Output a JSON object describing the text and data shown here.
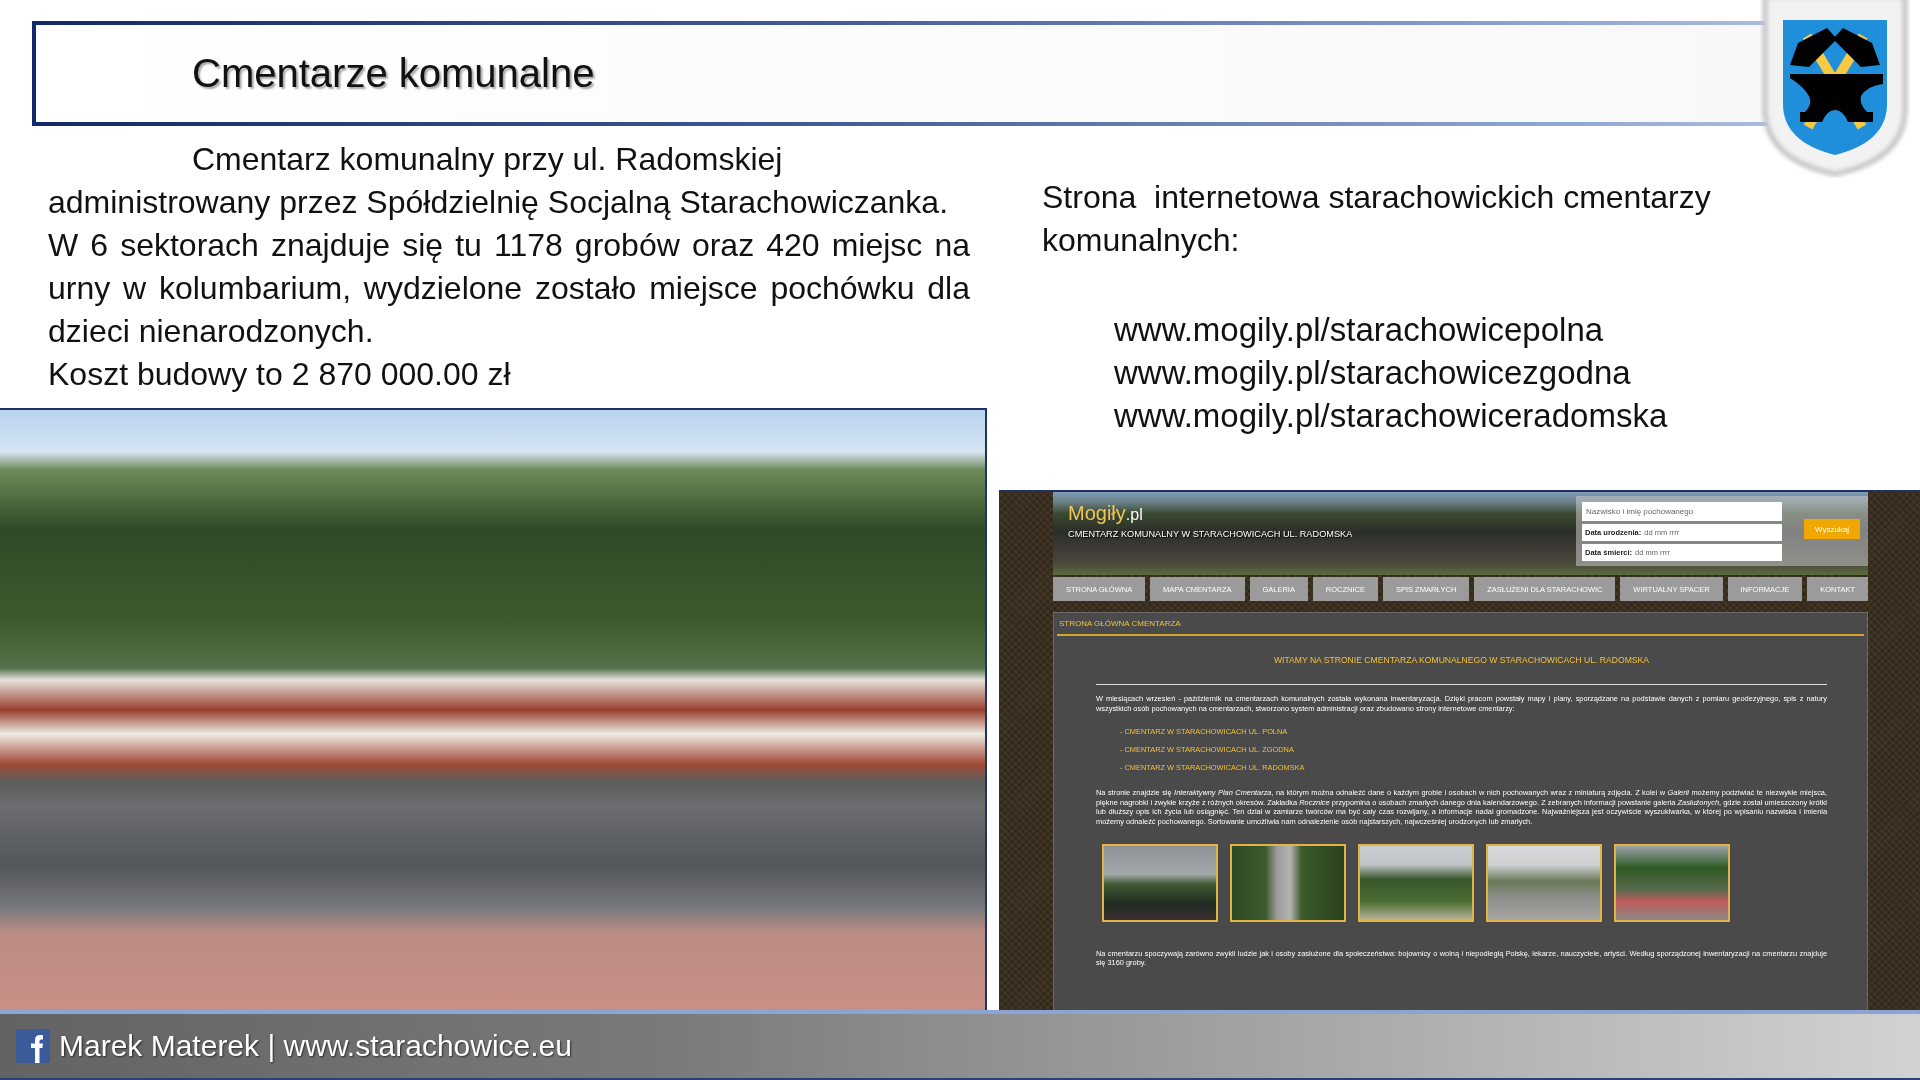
{
  "title": "Cmentarze komunalne",
  "intro": {
    "paragraphs": [
      "Cmentarz komunalny przy ul. Radomskiej\nadministrowany przez Spółdzielnię Socjalną Starachowiczanka.",
      "W 6 sektorach znajduje się tu 1178 grobów oraz 420 miejsc na urny w kolumbarium, wydzielone zostało miejsce pochówku dla dzieci nienarodzonych.",
      "Koszt budowy to 2 870 000.00 zł"
    ]
  },
  "links_intro": "Strona  internetowa starachowickich cmentarzy komunalnych:",
  "links": [
    "www.mogily.pl/starachowicepolna",
    "www.mogily.pl/starachowicezgodna",
    "www.mogily.pl/starachowiceradomska"
  ],
  "website": {
    "logo": {
      "name": "Mogiły",
      "suffix": ".pl"
    },
    "subtitle": "CMENTARZ KOMUNALNY W STARACHOWICACH UL. RADOMSKA",
    "search": {
      "name_placeholder": "Nazwisko i imię pochowanego",
      "date_fields": [
        {
          "label": "Data urodzenia:",
          "placeholder": "dd mm rrrr"
        },
        {
          "label": "Data śmierci:",
          "placeholder": "dd mm rrrr"
        }
      ],
      "button": "Wyszukaj"
    },
    "nav": [
      "STRONA GŁÓWNA",
      "MAPA CMENTARZA",
      "GALERIA",
      "ROCZNICE",
      "SPIS ZMARŁYCH",
      "ZASŁUŻENI DLA STARACHOWIC",
      "WIRTUALNY SPACER",
      "INFORMACJE",
      "KONTAKT"
    ],
    "section_title": "STRONA GŁÓWNA CMENTARZA",
    "heading": "WITAMY NA STRONIE CMENTARZA KOMUNALNEGO W STARACHOWICACH UL. RADOMSKA",
    "intro": "W miesiącach wrzesień - październik na cmentarzach komunalnych została wykonana inwentaryzacja. Dzięki pracom powstały mapy i plany, sporządzane na podstawie danych z pomiaru geodezyjnego, spis z natury wszystkich osób pochowanych na cmentarzach, stworzono system administracji oraz zbudowano strony internetowe cmentarzy:",
    "cemetery_links": [
      "- CMENTARZ W STARACHOWICACH UL. POLNA",
      "- CMENTARZ W STARACHOWICACH UL. ZGODNA",
      "- CMENTARZ W STARACHOWICACH UL. RADOMSKA"
    ],
    "description": "Na stronie znajdzie się *Interaktywny Plan Cmentarza*, na którym można odnaleźć dane o każdym grobie i osobach w nich pochowanych wraz z miniaturą zdjęcia. Z kolei w *Galerii* możemy podziwiać te niezwykłe miejsca, piękne nagrobki i zwykłe krzyże z różnych okresów. Zakładka *Rocznice* przypomina o osobach zmarłych danego dnia kalendarzowego. Z zebranych informacji powstanie galeria *Zasłużonych*, gdzie został umieszczony krótki lub dłuższy opis ich życia lub osiągnięć. Ten dział w zamiarze twórców ma być cały czas rozwijany, a informacje nadal gromadzone. Najważniejsza jest oczywiście wyszukiwarka, w której po wpisaniu nazwiska i imienia możemy odnaleźć pochowanego. Sortowanie umożliwia nam odnalezienie osób najstarszych, najwcześniej urodzonych lub zmarłych.",
    "closing": "Na cmentarzu spoczywają zarówno zwykli ludzie jak i osoby zasłużone dla społeczeństwa: bojownicy o wolną i niepodległą Polskę, lekarze, nauczyciele, artyści. Według sporządzonej inwentaryzacji na cmentarzu znajduje się 3160 groby."
  },
  "footer": {
    "text": "Marek Materek | www.starachowice.eu"
  }
}
